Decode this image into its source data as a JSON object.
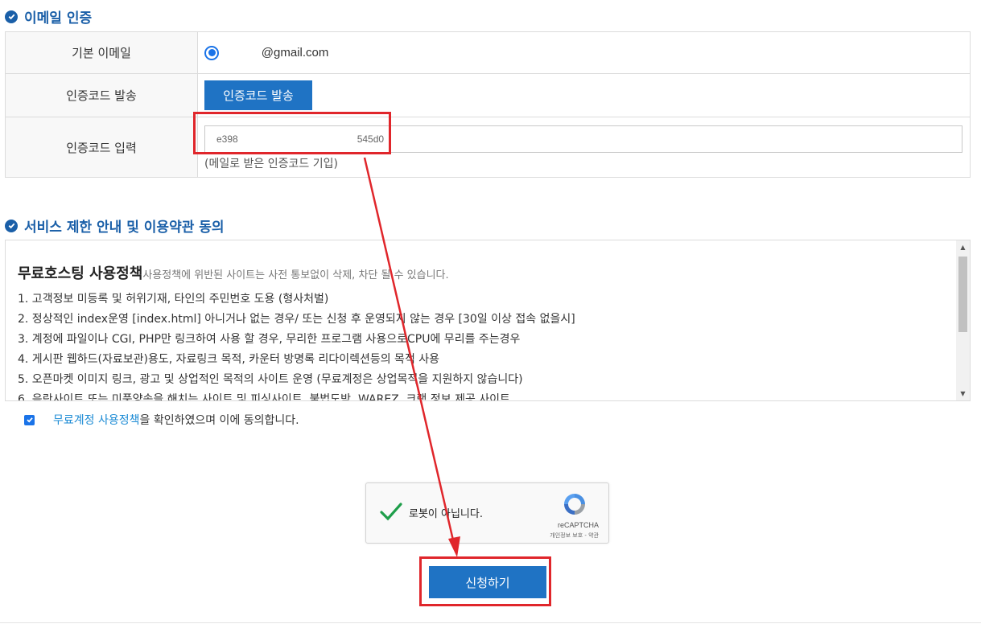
{
  "email_section": {
    "title": "이메일 인증",
    "rows": {
      "primary_email_label": "기본 이메일",
      "primary_email_value": "@gmail.com",
      "send_code_label": "인증코드 발송",
      "send_code_button": "인증코드 발송",
      "code_input_label": "인증코드 입력",
      "code_input_value_start": "e398",
      "code_input_value_end": "545d0",
      "code_input_hint": "(메일로 받은 인증코드 기입)"
    }
  },
  "terms_section": {
    "title": "서비스 제한 안내 및 이용약관 동의",
    "policy_title": "무료호스팅 사용정책",
    "policy_subtitle": "사용정책에 위반된 사이트는 사전 통보없이 삭제, 차단 될 수 있습니다.",
    "items": [
      "1. 고객정보 미등록 및 허위기재, 타인의 주민번호 도용 (형사처벌)",
      "2. 정상적인 index운영 [index.html] 아니거나 없는 경우/ 또는 신청 후 운영되지 않는 경우 [30일 이상 접속 없을시]",
      "3. 계정에 파일이나 CGI, PHP만 링크하여 사용 할 경우, 무리한 프로그램 사용으로CPU에 무리를 주는경우",
      "4. 게시판 웹하드(자료보관)용도, 자료링크 목적, 카운터 방명록 리다이렉션등의 목적 사용",
      "5. 오픈마켓 이미지 링크, 광고 및 상업적인 목적의 사이트 운영 (무료계정은 상업목적을 지원하지 않습니다)",
      "6. 음란사이트 또는 미풍양속을 해치는 사이트 및 피싱사이트, 불법도박, WAREZ, 크랙 정보 제공 사이트"
    ],
    "agree_link": "무료계정 사용정책",
    "agree_text": "을 확인하였으며 이에 동의합니다.",
    "agree_checked": true
  },
  "recaptcha": {
    "label": "로봇이 아닙니다.",
    "brand": "reCAPTCHA",
    "terms": "개인정보 보호 - 약관",
    "verified": true
  },
  "apply_button": "신청하기",
  "colors": {
    "brand_blue": "#1a5fa8",
    "button_blue": "#1f73c4",
    "highlight_red": "#e0262b"
  }
}
